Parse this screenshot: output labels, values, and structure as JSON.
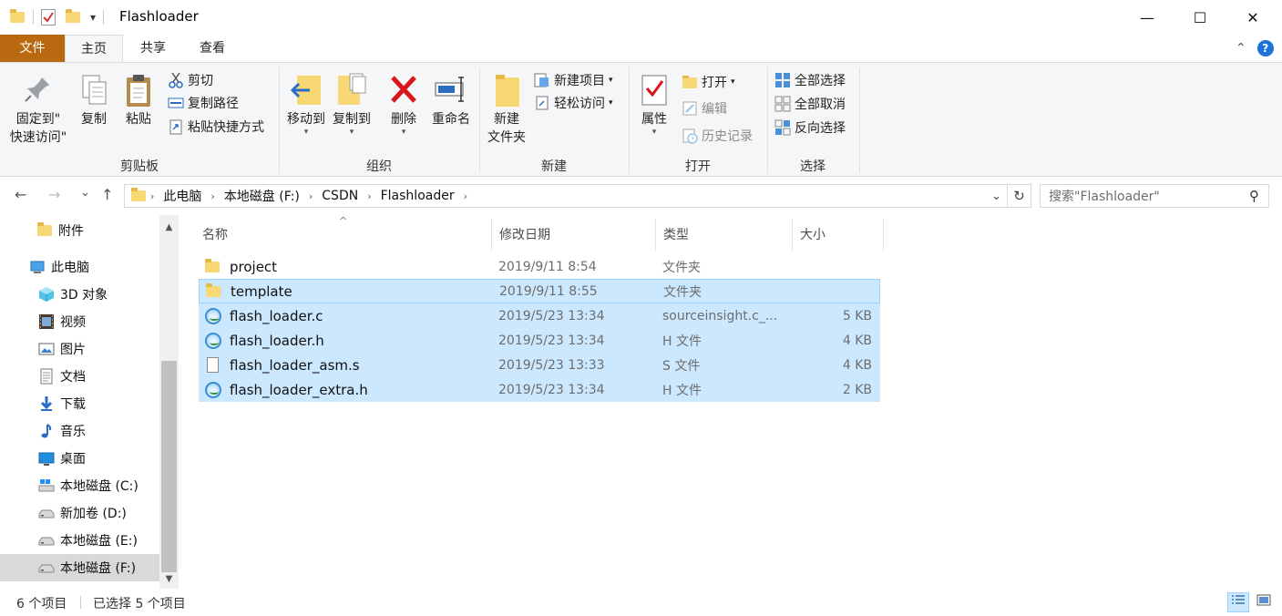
{
  "window": {
    "title": "Flashloader",
    "qa_dropdown": "▾",
    "minimize": "—",
    "maximize": "☐",
    "close": "✕"
  },
  "ribbon_tabs": [
    {
      "label": "文件"
    },
    {
      "label": "主页"
    },
    {
      "label": "共享"
    },
    {
      "label": "查看"
    }
  ],
  "ribbon_right": {
    "collapse": "⌃",
    "help": "?"
  },
  "clipboard": {
    "pin_line1": "固定到\"",
    "pin_line2": "快速访问\"",
    "copy": "复制",
    "paste": "粘贴",
    "cut": "剪切",
    "copy_path": "复制路径",
    "paste_shortcut": "粘贴快捷方式",
    "label": "剪贴板"
  },
  "organize": {
    "move_to": "移动到",
    "copy_to": "复制到",
    "delete": "删除",
    "rename": "重命名",
    "label": "组织"
  },
  "new_group": {
    "new_folder_line1": "新建",
    "new_folder_line2": "文件夹",
    "new_item": "新建项目",
    "easy_access": "轻松访问",
    "label": "新建"
  },
  "open_group": {
    "properties": "属性",
    "open": "打开",
    "edit": "编辑",
    "history": "历史记录",
    "label": "打开"
  },
  "select_group": {
    "select_all": "全部选择",
    "select_none": "全部取消",
    "invert": "反向选择",
    "label": "选择"
  },
  "nav": {
    "back": "←",
    "forward": "→",
    "recent": "⌄",
    "up": "↑",
    "breadcrumb": [
      "此电脑",
      "本地磁盘 (F:)",
      "CSDN",
      "Flashloader"
    ],
    "dropdown": "⌄",
    "refresh": "↻",
    "search_placeholder": "搜索\"Flashloader\"",
    "search_icon": "⚲"
  },
  "sidebar": {
    "items": [
      {
        "label": "附件",
        "icon": "folder-icon"
      },
      {
        "label": "此电脑",
        "icon": "computer-icon"
      },
      {
        "label": "3D 对象",
        "icon": "3d-objects-icon"
      },
      {
        "label": "视频",
        "icon": "video-icon"
      },
      {
        "label": "图片",
        "icon": "pictures-icon"
      },
      {
        "label": "文档",
        "icon": "documents-icon"
      },
      {
        "label": "下载",
        "icon": "download-icon"
      },
      {
        "label": "音乐",
        "icon": "music-icon"
      },
      {
        "label": "桌面",
        "icon": "desktop-icon"
      },
      {
        "label": "本地磁盘 (C:)",
        "icon": "drive-windows-icon"
      },
      {
        "label": "新加卷 (D:)",
        "icon": "drive-icon"
      },
      {
        "label": "本地磁盘 (E:)",
        "icon": "drive-icon"
      },
      {
        "label": "本地磁盘 (F:)",
        "icon": "drive-icon",
        "selected": true
      }
    ],
    "scroll_up": "▲",
    "scroll_down": "▼"
  },
  "columns": {
    "name": "名称",
    "date": "修改日期",
    "type": "类型",
    "size": "大小",
    "sort_indicator": "^"
  },
  "files": [
    {
      "name": "project",
      "date": "2019/9/11 8:54",
      "type": "文件夹",
      "size": "",
      "icon": "folder-icon",
      "selected": false
    },
    {
      "name": "template",
      "date": "2019/9/11 8:55",
      "type": "文件夹",
      "size": "",
      "icon": "folder-icon",
      "selected": true
    },
    {
      "name": "flash_loader.c",
      "date": "2019/5/23 13:34",
      "type": "sourceinsight.c_...",
      "size": "5 KB",
      "icon": "sourceinsight-file-icon",
      "selected": true
    },
    {
      "name": "flash_loader.h",
      "date": "2019/5/23 13:34",
      "type": "H 文件",
      "size": "4 KB",
      "icon": "sourceinsight-file-icon",
      "selected": true
    },
    {
      "name": "flash_loader_asm.s",
      "date": "2019/5/23 13:33",
      "type": "S 文件",
      "size": "4 KB",
      "icon": "blank-file-icon",
      "selected": true
    },
    {
      "name": "flash_loader_extra.h",
      "date": "2019/5/23 13:34",
      "type": "H 文件",
      "size": "2 KB",
      "icon": "sourceinsight-file-icon",
      "selected": true
    }
  ],
  "status": {
    "count": "6 个项目",
    "selected": "已选择 5 个项目"
  }
}
